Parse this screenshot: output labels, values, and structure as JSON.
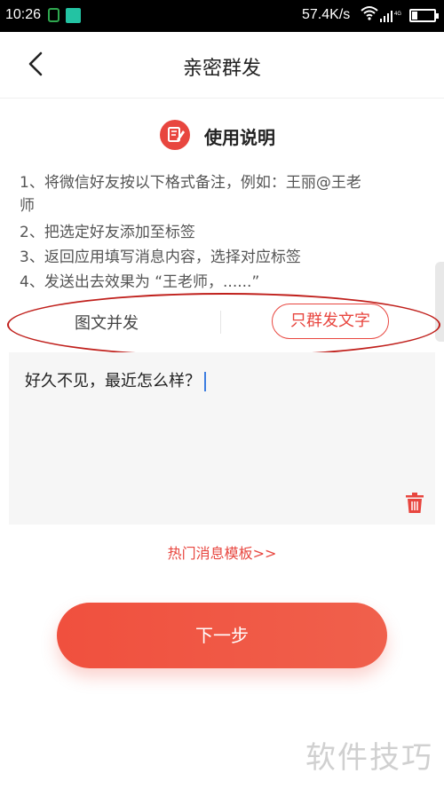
{
  "status_bar": {
    "time": "10:26",
    "speed": "57.4K/s",
    "signal_text": "4G",
    "battery_level": 0.25,
    "colors": {
      "app_icon": "#2fa84f",
      "app_icon2": "#23c3a3"
    }
  },
  "nav": {
    "back_icon": "chevron-left-icon",
    "title": "亲密群发"
  },
  "instructions": {
    "title": "使用说明",
    "icon": "edit-note-icon",
    "lines": [
      "1、将微信好友按以下格式备注，例如：王丽@王老",
      "师",
      "2、把选定好友添加至标签",
      "3、返回应用填写消息内容，选择对应标签",
      "4、发送出去效果为 “王老师，......”"
    ]
  },
  "mode_tabs": {
    "left": "图文并发",
    "right": "只群发文字",
    "selected": "right"
  },
  "message": {
    "text": "好久不见，最近怎么样？",
    "delete_icon": "trash-icon"
  },
  "template_link": "热门消息模板>>",
  "next_button": "下一步",
  "watermark": "软件技巧",
  "colors": {
    "accent": "#e8463f",
    "highlight_ellipse": "#c0201c",
    "button_gradient_start": "#f0503e",
    "button_gradient_end": "#f0604c",
    "caret": "#3c7de0"
  }
}
